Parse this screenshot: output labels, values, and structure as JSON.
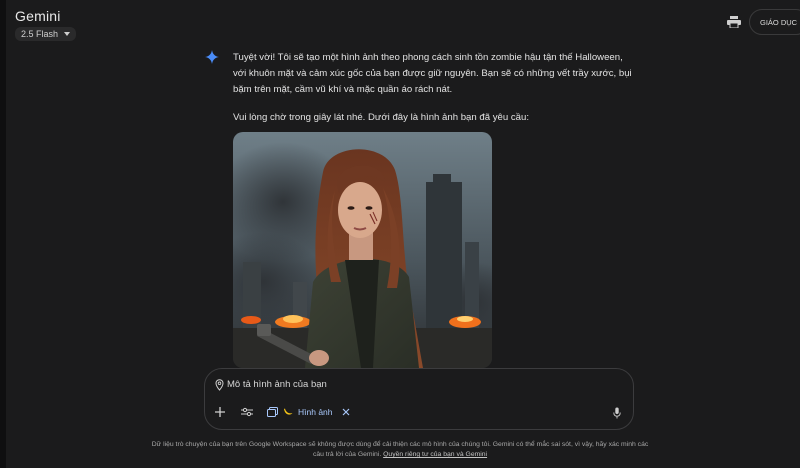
{
  "header": {
    "app_title": "Gemini",
    "model_label": "2.5 Flash",
    "edu_label": "GIÁO DỤC"
  },
  "conversation": {
    "paragraph_1": "Tuyệt vời! Tôi sẽ tạo một hình ảnh theo phong cách sinh tồn zombie hậu tận thế Halloween, với khuôn mặt và cảm xúc gốc của bạn được giữ nguyên. Bạn sẽ có những vết trầy xước, bụi bặm trên mặt, cầm vũ khí và mặc quần áo rách nát.",
    "paragraph_2": "Vui lòng chờ trong giây lát nhé. Dưới đây là hình ảnh bạn đã yêu cầu:"
  },
  "composer": {
    "placeholder": "Mô tả hình ảnh của bạn",
    "tool_chip_label": "Hình ảnh"
  },
  "footer": {
    "disclaimer": "Dữ liệu trò chuyện của bạn trên Google Workspace sẽ không được dùng để cải thiện các mô hình của chúng tôi. Gemini có thể mắc sai sót, vì vậy, hãy xác minh các câu trả lời của Gemini.",
    "privacy_link": "Quyền riêng tư của bạn và Gemini"
  },
  "colors": {
    "background": "#1b1b1c",
    "accent": "#a8c7fa",
    "spark": "#4a8cf7"
  },
  "icons": [
    "printer-icon",
    "sparkle-icon",
    "location-pin-icon",
    "plus-icon",
    "tune-icon",
    "image-gallery-icon",
    "banana-icon",
    "close-icon",
    "mic-icon"
  ]
}
